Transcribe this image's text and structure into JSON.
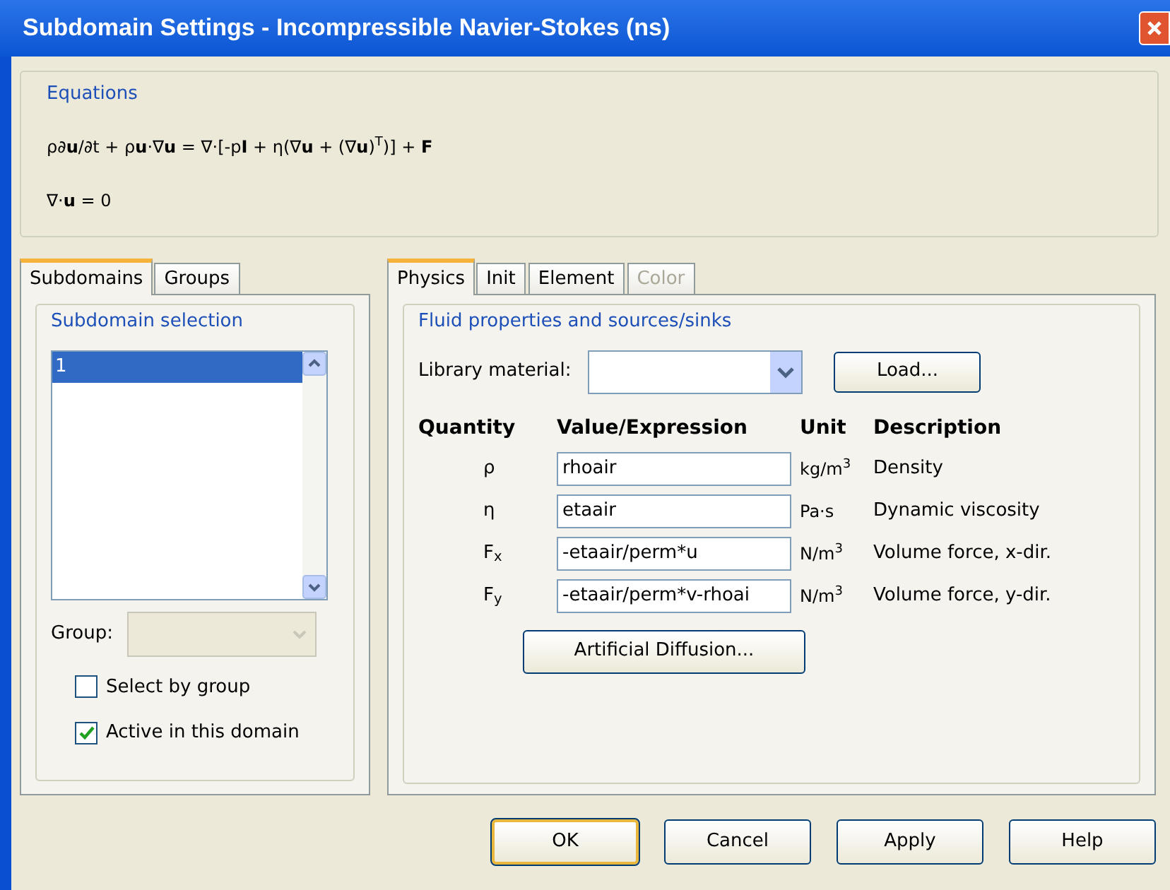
{
  "window": {
    "title": "Subdomain Settings - Incompressible Navier-Stokes (ns)"
  },
  "equations": {
    "title": "Equations",
    "lines": [
      "ρ∂**u**/∂t + ρ**u**·∇**u** = ∇·[-p**I** + η(∇**u** + (∇**u**)$^{T}$)] + **F**",
      "∇·**u** = 0"
    ]
  },
  "left_tabs": [
    {
      "label": "Subdomains",
      "selected": true
    },
    {
      "label": "Groups",
      "selected": false
    }
  ],
  "subdomain_selection": {
    "title": "Subdomain selection",
    "items": [
      {
        "label": "1",
        "selected": true
      }
    ],
    "group_label": "Group:",
    "group_disabled": true,
    "checkboxes": [
      {
        "label": "Select by group",
        "checked": false
      },
      {
        "label": "Active in this domain",
        "checked": true
      }
    ]
  },
  "right_tabs": [
    {
      "label": "Physics",
      "selected": true,
      "disabled": false
    },
    {
      "label": "Init",
      "selected": false,
      "disabled": false
    },
    {
      "label": "Element",
      "selected": false,
      "disabled": false
    },
    {
      "label": "Color",
      "selected": false,
      "disabled": true
    }
  ],
  "fluid": {
    "title": "Fluid properties and sources/sinks",
    "library_label": "Library material:",
    "load_button": "Load...",
    "columns": [
      "Quantity",
      "Value/Expression",
      "Unit",
      "Description"
    ],
    "rows": [
      {
        "quantity": "ρ",
        "value": "rhoair",
        "unit": "kg/m$^{3}$",
        "description": "Density"
      },
      {
        "quantity": "η",
        "value": "etaair",
        "unit": "Pa·s",
        "description": "Dynamic viscosity"
      },
      {
        "quantity": "F$_{x}$",
        "value": "-etaair/perm*u",
        "unit": "N/m$^{3}$",
        "description": "Volume force, x-dir."
      },
      {
        "quantity": "F$_{y}$",
        "value": "-etaair/perm*v-rhoai",
        "unit": "N/m$^{3}$",
        "description": "Volume force, y-dir."
      }
    ],
    "diffusion_button": "Artificial Diffusion..."
  },
  "buttons": [
    {
      "label": "OK",
      "default": true
    },
    {
      "label": "Cancel",
      "default": false
    },
    {
      "label": "Apply",
      "default": false
    },
    {
      "label": "Help",
      "default": false
    }
  ]
}
